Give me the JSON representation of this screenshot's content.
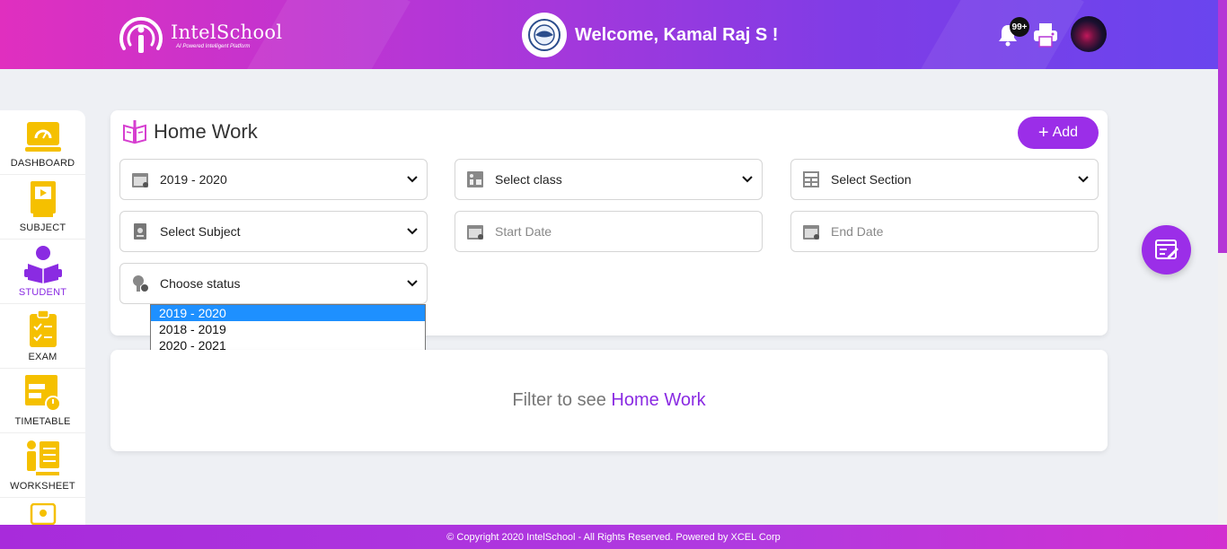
{
  "header": {
    "brand_name": "IntelSchool",
    "brand_tagline": "AI Powered Intelligent Platform",
    "welcome": "Welcome, Kamal Raj S !",
    "notification_count": "99+",
    "icons": [
      "bell-icon",
      "printer-icon",
      "user-avatar"
    ]
  },
  "sidebar": {
    "items": [
      {
        "label": "DASHBOARD",
        "icon": "dashboard-icon"
      },
      {
        "label": "SUBJECT",
        "icon": "subject-icon"
      },
      {
        "label": "STUDENT",
        "icon": "student-icon",
        "active": true
      },
      {
        "label": "EXAM",
        "icon": "exam-icon"
      },
      {
        "label": "TIMETABLE",
        "icon": "timetable-icon"
      },
      {
        "label": "WORKSHEET",
        "icon": "worksheet-icon"
      }
    ]
  },
  "homework": {
    "title": "Home Work",
    "add_label": "Add",
    "filters": {
      "year": "2019 - 2020",
      "class": "Select class",
      "section": "Select Section",
      "subject": "Select Subject",
      "start_date_placeholder": "Start Date",
      "end_date_placeholder": "End Date",
      "status": "Choose status"
    },
    "year_options": [
      "2019 - 2020",
      "2018 - 2019",
      "2020 - 2021"
    ],
    "selected_year_option": "2019 - 2020"
  },
  "result": {
    "prefix": "Filter to see",
    "highlight": "Home Work"
  },
  "footer": {
    "text": "© Copyright 2020 IntelSchool - All Rights Reserved. Powered by XCEL Corp"
  },
  "colors": {
    "accent": "#9b2ee8",
    "header_start": "#e02fbf",
    "header_end": "#6a45ee",
    "icon_yellow": "#f5c000",
    "selected_option": "#1e90ff"
  }
}
